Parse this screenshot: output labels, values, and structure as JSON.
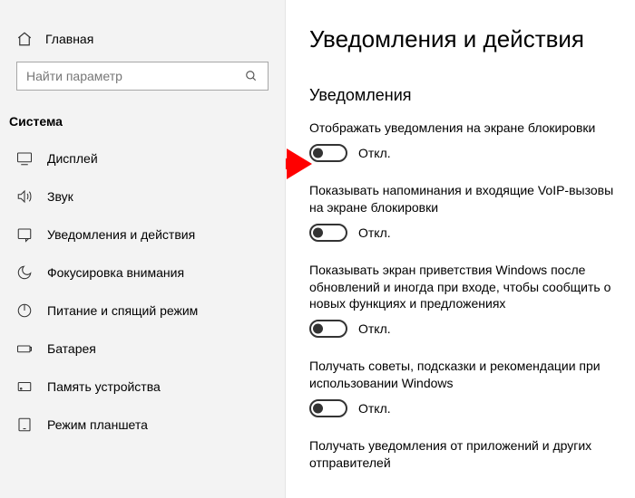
{
  "sidebar": {
    "home_label": "Главная",
    "search_placeholder": "Найти параметр",
    "section_title": "Система",
    "items": [
      {
        "label": "Дисплей"
      },
      {
        "label": "Звук"
      },
      {
        "label": "Уведомления и действия"
      },
      {
        "label": "Фокусировка внимания"
      },
      {
        "label": "Питание и спящий режим"
      },
      {
        "label": "Батарея"
      },
      {
        "label": "Память устройства"
      },
      {
        "label": "Режим планшета"
      }
    ]
  },
  "main": {
    "page_title": "Уведомления и действия",
    "section_title": "Уведомления",
    "settings": [
      {
        "desc": "Отображать уведомления на экране блокировки",
        "state_label": "Откл."
      },
      {
        "desc": "Показывать напоминания и входящие VoIP-вызовы на экране блокировки",
        "state_label": "Откл."
      },
      {
        "desc": "Показывать экран приветствия Windows после обновлений и иногда при входе, чтобы сообщить о новых функциях и предложениях",
        "state_label": "Откл."
      },
      {
        "desc": "Получать советы, подсказки и рекомендации при использовании Windows",
        "state_label": "Откл."
      },
      {
        "desc": "Получать уведомления от приложений и других отправителей",
        "state_label": ""
      }
    ]
  }
}
